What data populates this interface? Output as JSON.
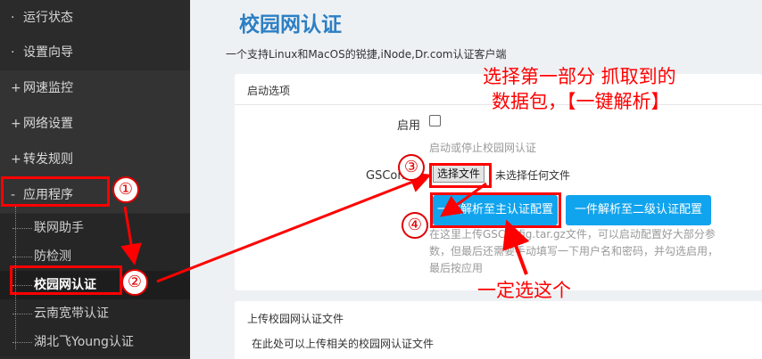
{
  "sidebar": {
    "items": [
      {
        "prefix": "·",
        "label": "运行状态"
      },
      {
        "prefix": "·",
        "label": "设置向导"
      },
      {
        "prefix": "+",
        "label": "网速监控"
      },
      {
        "prefix": "+",
        "label": "网络设置"
      },
      {
        "prefix": "+",
        "label": "转发规则"
      },
      {
        "prefix": "-",
        "label": "应用程序"
      }
    ],
    "subitems": [
      {
        "label": "联网助手"
      },
      {
        "label": "防检测"
      },
      {
        "label": "校园网认证"
      },
      {
        "label": "云南宽带认证"
      },
      {
        "label": "湖北飞Young认证"
      }
    ]
  },
  "main": {
    "title": "校园网认证",
    "description": "一个支持Linux和MacOS的锐捷,iNode,Dr.com认证客户端",
    "panel1": {
      "header": "启动选项",
      "enable_label": "启用",
      "enable_hint": "启动或停止校园网认证",
      "gsconfig_label": "GSConfig:",
      "file_button": "选择文件",
      "file_none": "未选择任何文件",
      "parse_main_button": "一件解析至主认证配置",
      "parse_secondary_button": "一件解析至二级认证配置",
      "upload_hint": "在这里上传GSConfig.tar.gz文件，可以启动配置好大部分参数，但最后还需要手动填写一下用户名和密码，并勾选启用，最后按应用"
    },
    "panel2": {
      "header": "上传校园网认证文件",
      "description": "在此处可以上传相关的校园网认证文件"
    }
  },
  "annotations": {
    "circle1": "①",
    "circle2": "②",
    "circle3": "③",
    "circle4": "④",
    "note_top_line1": "选择第一部分 抓取到的",
    "note_top_line2": "数据包，【一键解析】",
    "note_bottom": "一定选这个",
    "color": "#ff0000"
  }
}
